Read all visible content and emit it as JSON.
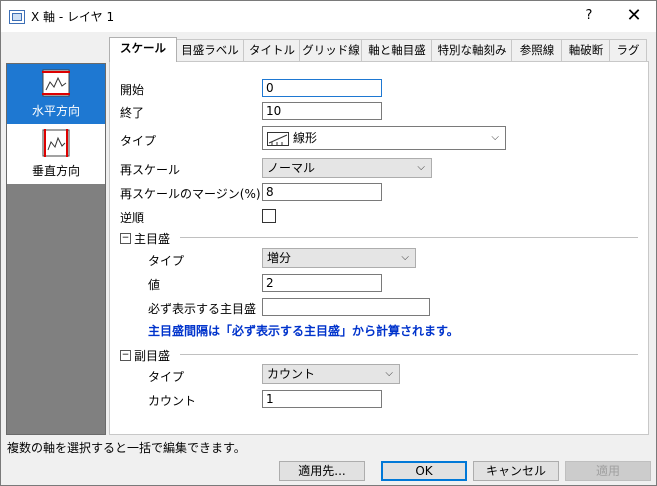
{
  "window": {
    "title": "X 軸 - レイヤ 1",
    "help": "?",
    "close": "✕"
  },
  "sidebar": {
    "items": [
      {
        "label": "水平方向",
        "selected": true
      },
      {
        "label": "垂直方向",
        "selected": false
      }
    ]
  },
  "tabs": [
    "スケール",
    "目盛ラベル",
    "タイトル",
    "グリッド線",
    "軸と軸目盛",
    "特別な軸刻み",
    "参照線",
    "軸破断",
    "ラグ"
  ],
  "active_tab": "スケール",
  "scale": {
    "start_label": "開始",
    "start_value": "0",
    "end_label": "終了",
    "end_value": "10",
    "type_label": "タイプ",
    "type_value": "線形",
    "rescale_label": "再スケール",
    "rescale_value": "ノーマル",
    "margin_label": "再スケールのマージン(%)",
    "margin_value": "8",
    "reverse_label": "逆順",
    "reverse_checked": false
  },
  "major": {
    "header": "主目盛",
    "collapse": "−",
    "type_label": "タイプ",
    "type_value": "増分",
    "value_label": "値",
    "value_value": "2",
    "required_label": "必ず表示する主目盛",
    "required_value": "",
    "info": "主目盛間隔は「必ず表示する主目盛」から計算されます。"
  },
  "minor": {
    "header": "副目盛",
    "collapse": "−",
    "type_label": "タイプ",
    "type_value": "カウント",
    "count_label": "カウント",
    "count_value": "1"
  },
  "status": "複数の軸を選択すると一括で編集できます。",
  "buttons": {
    "apply_to": "適用先...",
    "ok": "OK",
    "cancel": "キャンセル",
    "apply": "適用"
  },
  "colors": {
    "accent": "#1e78d2",
    "info_text": "#0033cc"
  }
}
